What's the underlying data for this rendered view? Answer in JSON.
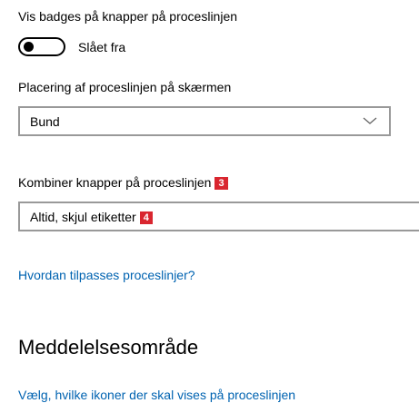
{
  "badges_setting": {
    "label": "Vis badges på knapper på proceslinjen",
    "toggle_state": "Slået fra",
    "toggle_on": false
  },
  "location_setting": {
    "label": "Placering af proceslinjen på skærmen",
    "selected": "Bund",
    "icon": "chevron-down-icon"
  },
  "combine_setting": {
    "label": "Kombiner knapper på proceslinjen",
    "label_badge": "3",
    "selected": "Altid, skjul etiketter",
    "selected_badge": "4"
  },
  "help_link": "Hvordan tilpasses proceslinjer?",
  "notification_section": {
    "title": "Meddelelsesområde",
    "link": "Vælg, hvilke ikoner der skal vises på proceslinjen"
  },
  "colors": {
    "badge": "#d9262f",
    "link": "#0063b1",
    "border": "#999999"
  }
}
